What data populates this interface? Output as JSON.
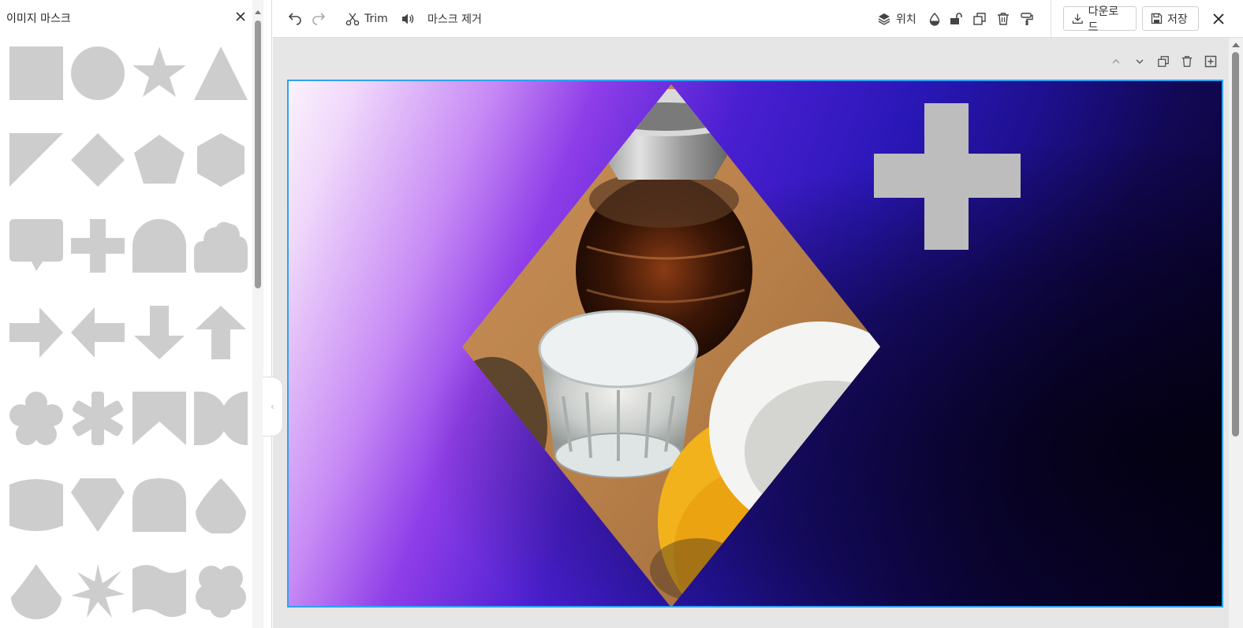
{
  "panel": {
    "title": "이미지 마스크",
    "close_icon": "close-icon",
    "shape_color": "#cdcdcd",
    "shapes": [
      "square",
      "circle",
      "star",
      "triangle",
      "right-triangle",
      "diamond",
      "pentagon",
      "hexagon",
      "speech-bubble",
      "cross",
      "arch",
      "cloud",
      "arrow-right",
      "arrow-left",
      "arrow-down",
      "arrow-up",
      "flower",
      "asterisk",
      "ribbon",
      "moon-split",
      "cylinder",
      "gem",
      "tombstone",
      "teardrop",
      "drop",
      "starburst",
      "wave-flag",
      "clover"
    ]
  },
  "toolbar": {
    "undo_icon": "undo-icon",
    "redo_icon": "redo-icon",
    "trim_label": "Trim",
    "trim_icon": "scissors-icon",
    "audio_icon": "speaker-icon",
    "remove_mask_label": "마스크 제거",
    "position_label": "위치",
    "position_icon": "layers-icon",
    "opacity_icon": "drop-icon",
    "lock_icon": "unlock-icon",
    "duplicate_icon": "duplicate-icon",
    "delete_icon": "trash-icon",
    "paint_icon": "paint-roller-icon",
    "download_label": "다운로드",
    "save_label": "저장",
    "close_icon": "close-icon"
  },
  "canvas": {
    "selection_color": "#2ea3f2",
    "mini_controls": [
      "chevron-up-icon",
      "chevron-down-icon",
      "duplicate-icon",
      "trash-icon",
      "add-page-icon"
    ],
    "plus_color": "#bdbdbd"
  }
}
